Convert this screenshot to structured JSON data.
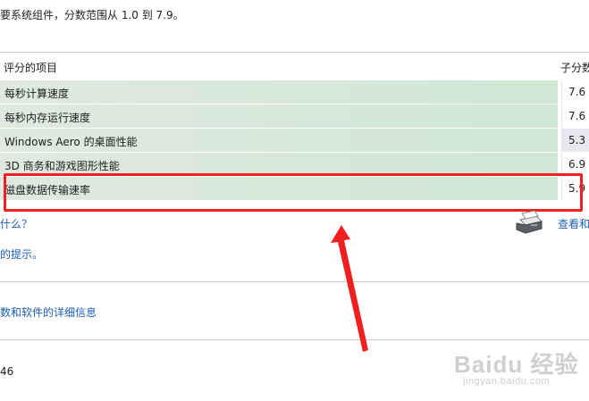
{
  "intro_text": "要系统组件，分数范围从 1.0 到 7.9。",
  "table": {
    "header_item": "评分的项目",
    "header_score": "子分数",
    "rows": [
      {
        "name": "每秒计算速度",
        "score": "7.6"
      },
      {
        "name": "每秒内存运行速度",
        "score": "7.6"
      },
      {
        "name": "Windows Aero 的桌面性能",
        "score": "5.3"
      },
      {
        "name": "3D 商务和游戏图形性能",
        "score": "6.9"
      },
      {
        "name": "磁盘数据传输速率",
        "score": "5.9"
      }
    ]
  },
  "links": {
    "what_mean": "什么？",
    "tips": "的提示。",
    "details": "数和软件的详细信息",
    "view_print": "查看和"
  },
  "footer_number": "46",
  "watermark": {
    "logo": "Baidu 经验",
    "url": "jingyan.baidu.com"
  },
  "annotation": {
    "highlight_color": "#ef2020",
    "arrow_color": "#ef2020"
  }
}
